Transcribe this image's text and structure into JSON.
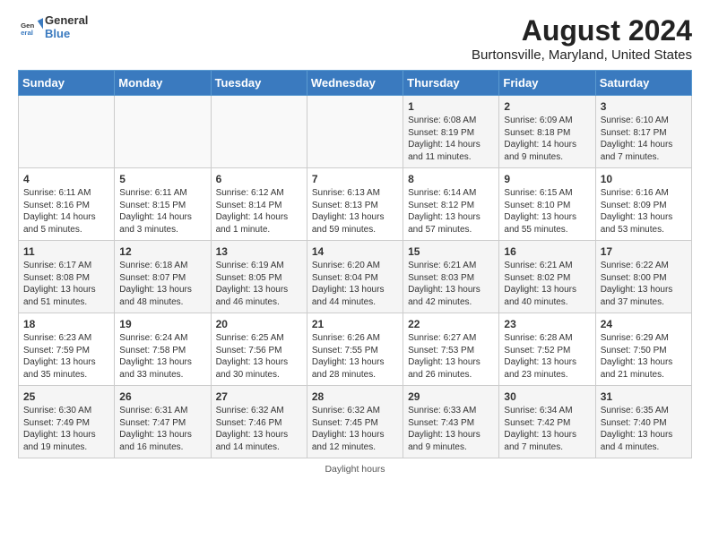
{
  "header": {
    "title": "August 2024",
    "subtitle": "Burtonsville, Maryland, United States"
  },
  "logo": {
    "line1": "General",
    "line2": "Blue"
  },
  "days_of_week": [
    "Sunday",
    "Monday",
    "Tuesday",
    "Wednesday",
    "Thursday",
    "Friday",
    "Saturday"
  ],
  "weeks": [
    [
      {
        "num": "",
        "info": ""
      },
      {
        "num": "",
        "info": ""
      },
      {
        "num": "",
        "info": ""
      },
      {
        "num": "",
        "info": ""
      },
      {
        "num": "1",
        "info": "Sunrise: 6:08 AM\nSunset: 8:19 PM\nDaylight: 14 hours and 11 minutes."
      },
      {
        "num": "2",
        "info": "Sunrise: 6:09 AM\nSunset: 8:18 PM\nDaylight: 14 hours and 9 minutes."
      },
      {
        "num": "3",
        "info": "Sunrise: 6:10 AM\nSunset: 8:17 PM\nDaylight: 14 hours and 7 minutes."
      }
    ],
    [
      {
        "num": "4",
        "info": "Sunrise: 6:11 AM\nSunset: 8:16 PM\nDaylight: 14 hours and 5 minutes."
      },
      {
        "num": "5",
        "info": "Sunrise: 6:11 AM\nSunset: 8:15 PM\nDaylight: 14 hours and 3 minutes."
      },
      {
        "num": "6",
        "info": "Sunrise: 6:12 AM\nSunset: 8:14 PM\nDaylight: 14 hours and 1 minute."
      },
      {
        "num": "7",
        "info": "Sunrise: 6:13 AM\nSunset: 8:13 PM\nDaylight: 13 hours and 59 minutes."
      },
      {
        "num": "8",
        "info": "Sunrise: 6:14 AM\nSunset: 8:12 PM\nDaylight: 13 hours and 57 minutes."
      },
      {
        "num": "9",
        "info": "Sunrise: 6:15 AM\nSunset: 8:10 PM\nDaylight: 13 hours and 55 minutes."
      },
      {
        "num": "10",
        "info": "Sunrise: 6:16 AM\nSunset: 8:09 PM\nDaylight: 13 hours and 53 minutes."
      }
    ],
    [
      {
        "num": "11",
        "info": "Sunrise: 6:17 AM\nSunset: 8:08 PM\nDaylight: 13 hours and 51 minutes."
      },
      {
        "num": "12",
        "info": "Sunrise: 6:18 AM\nSunset: 8:07 PM\nDaylight: 13 hours and 48 minutes."
      },
      {
        "num": "13",
        "info": "Sunrise: 6:19 AM\nSunset: 8:05 PM\nDaylight: 13 hours and 46 minutes."
      },
      {
        "num": "14",
        "info": "Sunrise: 6:20 AM\nSunset: 8:04 PM\nDaylight: 13 hours and 44 minutes."
      },
      {
        "num": "15",
        "info": "Sunrise: 6:21 AM\nSunset: 8:03 PM\nDaylight: 13 hours and 42 minutes."
      },
      {
        "num": "16",
        "info": "Sunrise: 6:21 AM\nSunset: 8:02 PM\nDaylight: 13 hours and 40 minutes."
      },
      {
        "num": "17",
        "info": "Sunrise: 6:22 AM\nSunset: 8:00 PM\nDaylight: 13 hours and 37 minutes."
      }
    ],
    [
      {
        "num": "18",
        "info": "Sunrise: 6:23 AM\nSunset: 7:59 PM\nDaylight: 13 hours and 35 minutes."
      },
      {
        "num": "19",
        "info": "Sunrise: 6:24 AM\nSunset: 7:58 PM\nDaylight: 13 hours and 33 minutes."
      },
      {
        "num": "20",
        "info": "Sunrise: 6:25 AM\nSunset: 7:56 PM\nDaylight: 13 hours and 30 minutes."
      },
      {
        "num": "21",
        "info": "Sunrise: 6:26 AM\nSunset: 7:55 PM\nDaylight: 13 hours and 28 minutes."
      },
      {
        "num": "22",
        "info": "Sunrise: 6:27 AM\nSunset: 7:53 PM\nDaylight: 13 hours and 26 minutes."
      },
      {
        "num": "23",
        "info": "Sunrise: 6:28 AM\nSunset: 7:52 PM\nDaylight: 13 hours and 23 minutes."
      },
      {
        "num": "24",
        "info": "Sunrise: 6:29 AM\nSunset: 7:50 PM\nDaylight: 13 hours and 21 minutes."
      }
    ],
    [
      {
        "num": "25",
        "info": "Sunrise: 6:30 AM\nSunset: 7:49 PM\nDaylight: 13 hours and 19 minutes."
      },
      {
        "num": "26",
        "info": "Sunrise: 6:31 AM\nSunset: 7:47 PM\nDaylight: 13 hours and 16 minutes."
      },
      {
        "num": "27",
        "info": "Sunrise: 6:32 AM\nSunset: 7:46 PM\nDaylight: 13 hours and 14 minutes."
      },
      {
        "num": "28",
        "info": "Sunrise: 6:32 AM\nSunset: 7:45 PM\nDaylight: 13 hours and 12 minutes."
      },
      {
        "num": "29",
        "info": "Sunrise: 6:33 AM\nSunset: 7:43 PM\nDaylight: 13 hours and 9 minutes."
      },
      {
        "num": "30",
        "info": "Sunrise: 6:34 AM\nSunset: 7:42 PM\nDaylight: 13 hours and 7 minutes."
      },
      {
        "num": "31",
        "info": "Sunrise: 6:35 AM\nSunset: 7:40 PM\nDaylight: 13 hours and 4 minutes."
      }
    ]
  ],
  "footer": "Daylight hours"
}
